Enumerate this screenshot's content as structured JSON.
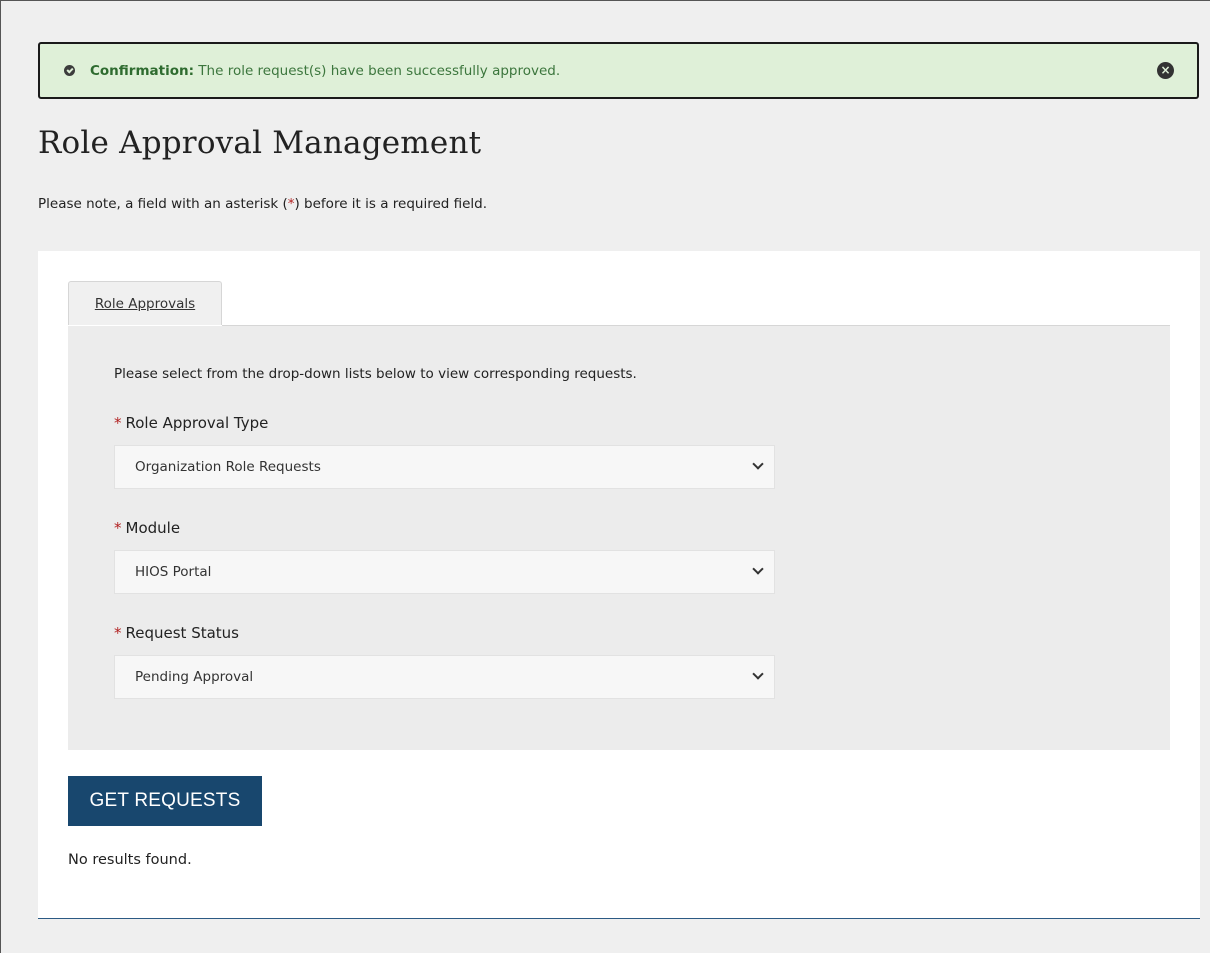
{
  "alert": {
    "icon": "check-circle-icon",
    "strong": "Confirmation:",
    "text": " The role request(s) have been successfully approved.",
    "close_icon": "close-circle-icon",
    "color": "#dff0d8"
  },
  "page_title": "Role Approval Management",
  "note": {
    "before": "Please note, a field with an asterisk (",
    "asterisk": "*",
    "after": ") before it is a required field."
  },
  "tabs": [
    {
      "label": "Role Approvals"
    }
  ],
  "form": {
    "instruction": "Please select from the drop-down lists below to view corresponding requests.",
    "fields": [
      {
        "label": "Role Approval Type",
        "value": "Organization Role Requests"
      },
      {
        "label": "Module",
        "value": "HIOS Portal"
      },
      {
        "label": "Request Status",
        "value": "Pending Approval"
      }
    ]
  },
  "button": {
    "label": "GET REQUESTS",
    "color": "#18476e"
  },
  "results_text": "No results found."
}
